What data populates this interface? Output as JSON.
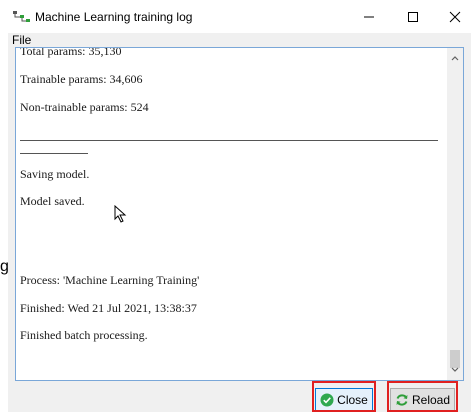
{
  "window": {
    "title": "Machine Learning training log",
    "menu": {
      "file": "File"
    }
  },
  "log": {
    "lines": [
      "Total params: 35,130",
      "Trainable params: 34,606",
      "Non-trainable params: 524",
      "Saving model.",
      "Model saved.",
      "Process: 'Machine Learning Training'",
      "Finished: Wed 21 Jul 2021, 13:38:37",
      "Finished batch processing."
    ]
  },
  "buttons": {
    "close": "Close",
    "reload": "Reload"
  },
  "page_fragment": "g",
  "colors": {
    "highlight": "#e02020",
    "close_icon_green": "#2fa84f",
    "reload_icon_green": "#2f9e3a",
    "focus_border": "#0078d7"
  },
  "icons": [
    "app-tree-icon",
    "minimize-icon",
    "maximize-icon",
    "close-icon",
    "scroll-up-icon",
    "scroll-down-icon",
    "pointer-cursor-icon",
    "check-circle-icon",
    "reload-icon"
  ]
}
